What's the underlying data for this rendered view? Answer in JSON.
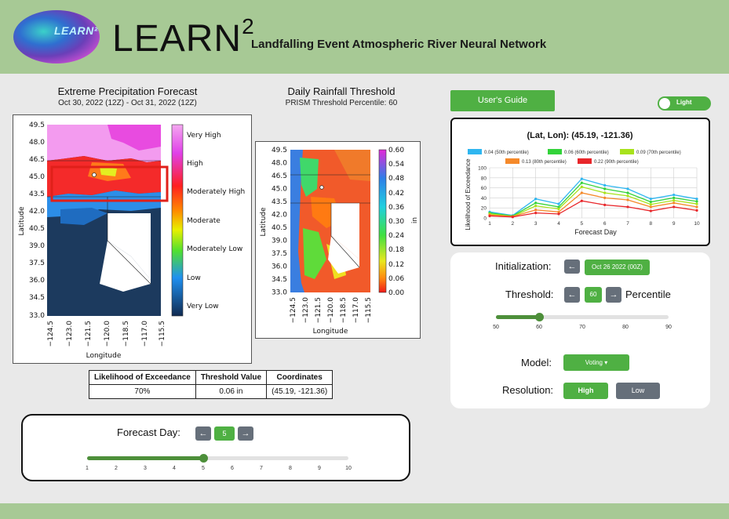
{
  "header": {
    "logo_text": "LEARN²",
    "title": "LEARN",
    "title_sup": "2",
    "subtitle": "Landfalling Event Atmospheric River Neural Network"
  },
  "forecast_panel": {
    "title": "Extreme Precipitation Forecast",
    "subtitle": "Oct 30, 2022 (12Z) - Oct 31, 2022 (12Z)",
    "xlabel": "Longitude",
    "ylabel": "Latitude",
    "y_ticks": [
      "49.5",
      "48.0",
      "46.5",
      "45.0",
      "43.5",
      "42.0",
      "40.5",
      "39.0",
      "37.5",
      "36.0",
      "34.5",
      "33.0"
    ],
    "x_ticks": [
      "−124.5",
      "−123.0",
      "−121.5",
      "−120.0",
      "−118.5",
      "−117.0",
      "−115.5"
    ],
    "legend": [
      "Very High",
      "High",
      "Moderately High",
      "Moderate",
      "Moderately Low",
      "Low",
      "Very Low"
    ]
  },
  "rainfall_panel": {
    "title": "Daily Rainfall Threshold",
    "subtitle": "PRISM Threshold Percentile: 60",
    "xlabel": "Longitude",
    "ylabel": "Latitude",
    "unit": "in",
    "y_ticks": [
      "49.5",
      "48.0",
      "46.5",
      "45.0",
      "43.5",
      "42.0",
      "40.5",
      "39.0",
      "37.5",
      "36.0",
      "34.5",
      "33.0"
    ],
    "x_ticks": [
      "−124.5",
      "−123.0",
      "−121.5",
      "−120.0",
      "−118.5",
      "−117.0",
      "−115.5"
    ],
    "colorbar_ticks": [
      "0.60",
      "0.54",
      "0.48",
      "0.42",
      "0.36",
      "0.30",
      "0.24",
      "0.18",
      "0.12",
      "0.06",
      "0.00"
    ]
  },
  "stats_table": {
    "headers": [
      "Likelihood of Exceedance",
      "Threshold Value",
      "Coordinates"
    ],
    "row": [
      "70%",
      "0.06 in",
      "(45.19, -121.36)"
    ]
  },
  "forecast_day": {
    "label": "Forecast Day:",
    "prev": "←",
    "value": "5",
    "next": "→",
    "ticks": [
      "1",
      "2",
      "3",
      "4",
      "5",
      "6",
      "7",
      "8",
      "9",
      "10"
    ],
    "position": 5
  },
  "controls": {
    "guide_label": "User's Guide",
    "theme_label": "Light",
    "init_label": "Initialization:",
    "init_prev": "←",
    "init_value": "Oct 26 2022 (00Z)",
    "threshold_label": "Threshold:",
    "threshold_prev": "←",
    "threshold_value": "60",
    "threshold_next": "→",
    "percentile_label": "Percentile",
    "threshold_ticks": [
      "50",
      "60",
      "70",
      "80",
      "90"
    ],
    "threshold_position": 60,
    "model_label": "Model:",
    "model_value": "Voting ▾",
    "resolution_label": "Resolution:",
    "res_high": "High",
    "res_low": "Low"
  },
  "colors": {
    "header": "#a7c995",
    "accent": "#4fb043",
    "slider": "#4d8f3a",
    "nav_button": "#666f7a"
  },
  "chart_data": {
    "type": "line",
    "title": "(Lat, Lon): (45.19, -121.36)",
    "xlabel": "Forecast Day",
    "ylabel": "Likelihood of Exceedance",
    "x": [
      1,
      2,
      3,
      4,
      5,
      6,
      7,
      8,
      9,
      10
    ],
    "ylim": [
      0,
      100
    ],
    "y_ticks": [
      0,
      20,
      40,
      60,
      80,
      100
    ],
    "grid": true,
    "series": [
      {
        "name": "0.04 (50th percentile)",
        "color": "#2fb6f0",
        "values": [
          12,
          5,
          38,
          28,
          78,
          65,
          58,
          38,
          46,
          38
        ]
      },
      {
        "name": "0.06 (60th percentile)",
        "color": "#33d33a",
        "values": [
          10,
          4,
          30,
          22,
          70,
          58,
          50,
          32,
          40,
          33
        ]
      },
      {
        "name": "0.09 (70th percentile)",
        "color": "#a8e21c",
        "values": [
          8,
          3,
          24,
          18,
          62,
          50,
          44,
          27,
          35,
          28
        ]
      },
      {
        "name": "0.13 (80th percentile)",
        "color": "#f5892a",
        "values": [
          6,
          3,
          16,
          12,
          50,
          40,
          36,
          22,
          30,
          22
        ]
      },
      {
        "name": "0.22 (90th percentile)",
        "color": "#e8262a",
        "values": [
          4,
          2,
          10,
          8,
          34,
          26,
          22,
          14,
          22,
          15
        ]
      }
    ]
  }
}
